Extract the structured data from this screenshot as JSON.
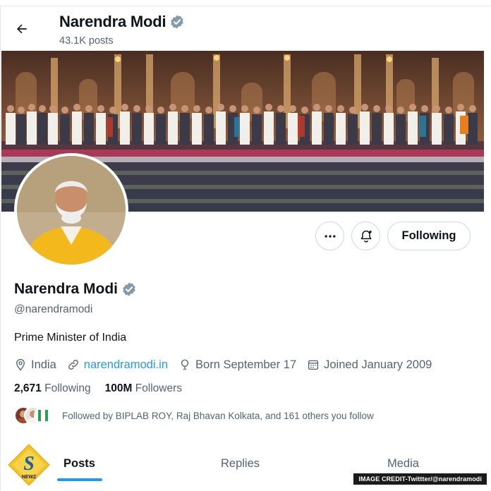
{
  "header": {
    "name": "Narendra Modi",
    "posts_count": "43.1K posts"
  },
  "profile": {
    "name": "Narendra Modi",
    "handle": "@narendramodi",
    "bio": "Prime Minister of India",
    "location": "India",
    "website": "narendramodi.in",
    "birthday": "Born September 17",
    "joined": "Joined January 2009",
    "following_count": "2,671",
    "following_label": "Following",
    "followers_count": "100M",
    "followers_label": "Followers",
    "followed_by": "Followed by BIPLAB ROY, Raj Bhavan Kolkata, and 161 others you follow"
  },
  "actions": {
    "following_button": "Following"
  },
  "tabs": [
    {
      "label": "Posts",
      "active": true
    },
    {
      "label": "Replies",
      "active": false
    },
    {
      "label": "Media",
      "active": false
    }
  ],
  "watermark": {
    "logo_text": "NEWZ",
    "logo_letter": "S",
    "credit": "IMAGE CREDIT-Twittter/@narendramodi"
  },
  "colors": {
    "accent": "#1d9bf0",
    "verified": "#829aab",
    "muted_text": "#536471"
  },
  "icons": [
    "back-arrow-icon",
    "verified-badge-icon",
    "more-icon",
    "notification-bell-icon",
    "location-icon",
    "link-icon",
    "birthday-icon",
    "calendar-icon"
  ]
}
